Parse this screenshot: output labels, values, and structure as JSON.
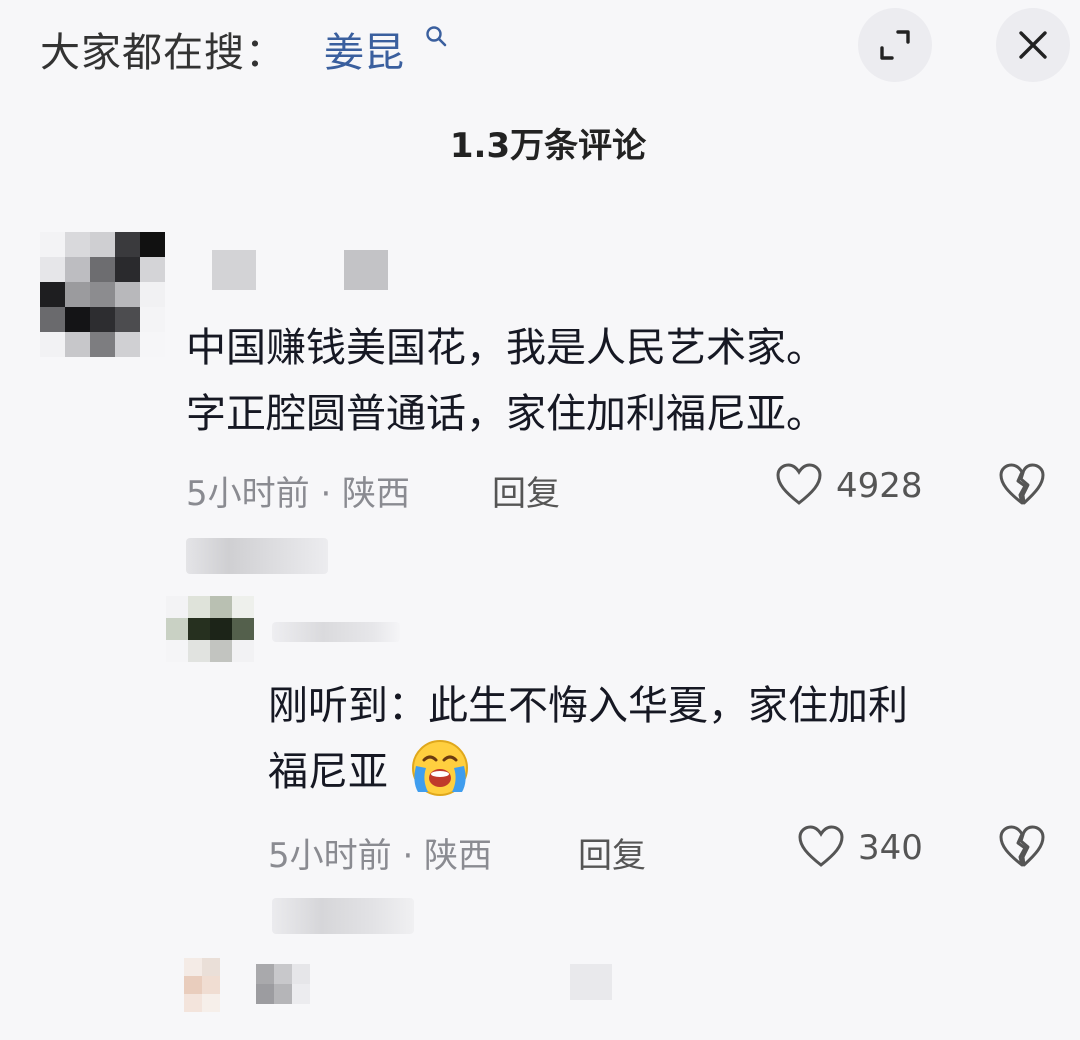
{
  "header": {
    "search_label": "大家都在搜：",
    "search_term": "姜昆",
    "comment_count": "1.3万条评论"
  },
  "comments": [
    {
      "lines": [
        "中国赚钱美国花，我是人民艺术家。",
        "字正腔圆普通话，家住加利福尼亚。"
      ],
      "time_location": "5小时前 · 陕西",
      "reply_label": "回复",
      "likes": "4928"
    },
    {
      "lines": [
        "刚听到：此生不悔入华夏，家住加利",
        "福尼亚"
      ],
      "time_location": "5小时前 · 陕西",
      "reply_label": "回复",
      "likes": "340"
    }
  ],
  "colors": {
    "background": "#f7f7f9",
    "link_blue": "#3a5f9e",
    "meta_gray": "#8a8b91"
  },
  "icons": [
    "search-icon",
    "expand-icon",
    "close-icon",
    "heart-icon",
    "broken-heart-icon",
    "crying-emoji-icon"
  ]
}
